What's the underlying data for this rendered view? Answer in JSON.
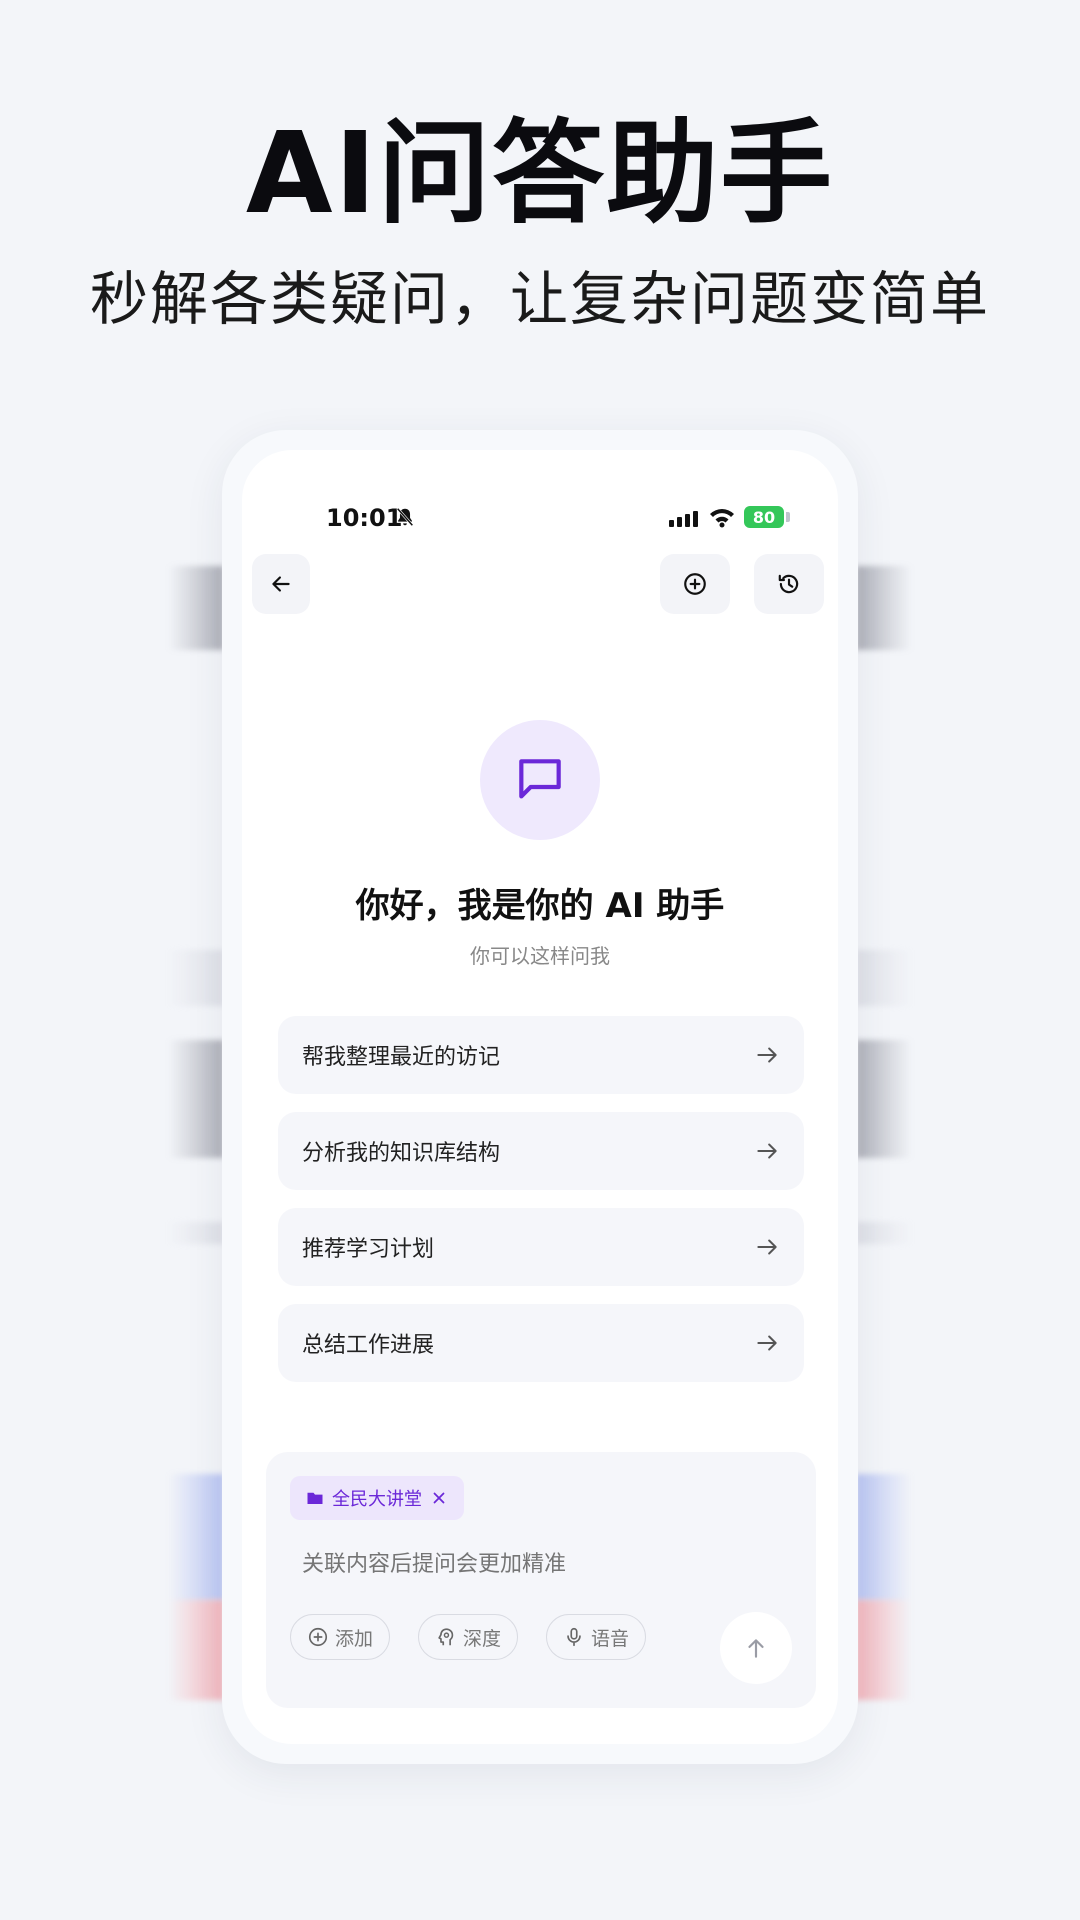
{
  "hero": {
    "title": "AI问答助手",
    "subtitle": "秒解各类疑问，让复杂问题变简单"
  },
  "status_bar": {
    "time": "10:01",
    "battery": "80",
    "icons": [
      "bell-slash-icon",
      "signal-icon",
      "wifi-icon",
      "battery-icon"
    ]
  },
  "nav": {
    "back_icon": "arrow-left-icon",
    "new_chat_icon": "plus-circle-icon",
    "history_icon": "history-icon"
  },
  "welcome": {
    "icon": "chat-bubble-icon",
    "greeting": "你好，我是你的 AI 助手",
    "hint": "你可以这样问我"
  },
  "suggestions": [
    {
      "label": "帮我整理最近的访记"
    },
    {
      "label": "分析我的知识库结构"
    },
    {
      "label": "推荐学习计划"
    },
    {
      "label": "总结工作进展"
    }
  ],
  "composer": {
    "tag": "全民大讲堂",
    "placeholder": "关联内容后提问会更加精准",
    "actions": [
      {
        "label": "添加",
        "icon": "plus-circle-icon"
      },
      {
        "label": "深度",
        "icon": "brain-head-icon"
      },
      {
        "label": "语音",
        "icon": "microphone-icon"
      }
    ],
    "send_icon": "arrow-up-icon"
  },
  "colors": {
    "accent": "#6b28d8",
    "accent_light": "#efe9fd",
    "battery": "#34c759",
    "background": "#f3f5f9"
  }
}
